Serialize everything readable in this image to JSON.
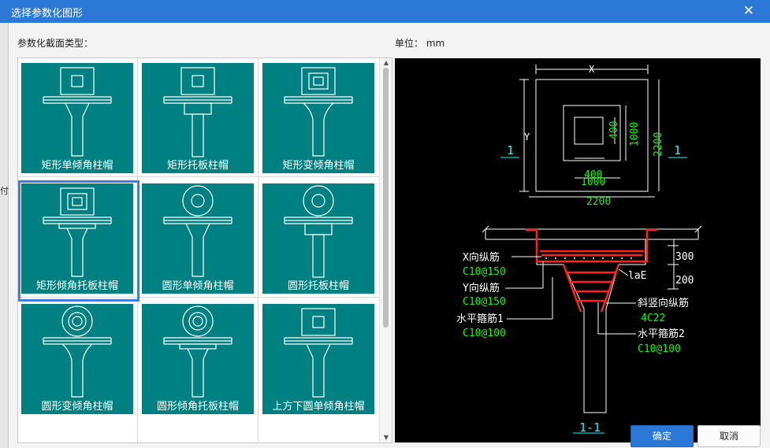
{
  "window": {
    "title": "选择参数化图形",
    "close_glyph": "✕"
  },
  "left_fragment": "付",
  "section_label": "参数化截面类型：",
  "unit": {
    "label": "单位：",
    "value": "mm"
  },
  "shapes": [
    {
      "label": "矩形单倾角柱帽",
      "head": "rect",
      "col": "taper"
    },
    {
      "label": "矩形托板柱帽",
      "head": "rect",
      "col": "plate"
    },
    {
      "label": "矩形变倾角柱帽",
      "head": "rect2",
      "col": "curve"
    },
    {
      "label": "矩形倾角托板柱帽",
      "head": "rect2",
      "col": "taperplate"
    },
    {
      "label": "圆形单倾角柱帽",
      "head": "circle",
      "col": "taper"
    },
    {
      "label": "圆形托板柱帽",
      "head": "circle",
      "col": "plate"
    },
    {
      "label": "圆形变倾角柱帽",
      "head": "circle2",
      "col": "curve"
    },
    {
      "label": "圆形倾角托板柱帽",
      "head": "circle2",
      "col": "taperplate"
    },
    {
      "label": "上方下圆单倾角柱帽",
      "head": "rect",
      "col": "taper"
    }
  ],
  "selected_index": 3,
  "preview": {
    "plan": {
      "dim_x": "X",
      "dim_y": "Y",
      "d400a": "400",
      "d400b": "400",
      "d1000a": "1000",
      "d1000b": "1000",
      "d2200a": "2200",
      "d2200b": "2200",
      "section_mark_left": "1",
      "section_mark_right": "1"
    },
    "section": {
      "d300": "300",
      "d200": "200",
      "x_rebar": "X向纵筋",
      "x_rebar_spec": "C10@150",
      "y_rebar": "Y向纵筋",
      "y_rebar_spec": "C10@150",
      "hoop1": "水平箍筋1",
      "hoop1_spec": "C10@100",
      "vert": "斜竖向纵筋",
      "vert_spec": "4C22",
      "hoop2": "水平箍筋2",
      "hoop2_spec": "C10@100",
      "lae": "laE",
      "title": "1-1"
    }
  },
  "buttons": {
    "ok": "确定",
    "cancel": "取消"
  },
  "colors": {
    "title_bar": "#2b78d6",
    "tile": "#008080",
    "selection": "#3f7ee0",
    "cad_green": "#00ff00",
    "cad_red": "#ff2020",
    "cad_cyan": "#00ffff"
  }
}
